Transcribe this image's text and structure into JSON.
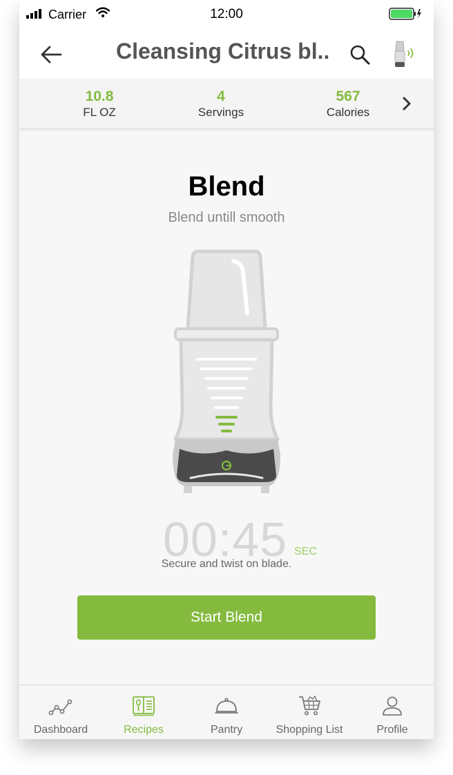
{
  "status_bar": {
    "carrier": "Carrier",
    "time": "12:00"
  },
  "nav": {
    "title": "Cleansing Citrus bl..",
    "back_icon": "arrow-left-icon",
    "search_icon": "search-icon",
    "device_icon": "blender-connected-icon"
  },
  "stats": [
    {
      "value": "10.8",
      "label": "FL OZ"
    },
    {
      "value": "4",
      "label": "Servings"
    },
    {
      "value": "567",
      "label": "Calories"
    }
  ],
  "step": {
    "title": "Blend",
    "description": "Blend untill smooth",
    "timer": "00:45",
    "timer_unit": "SEC",
    "note": "Secure and twist on blade.",
    "button_label": "Start Blend"
  },
  "tabs": [
    {
      "label": "Dashboard",
      "icon": "chart-line-icon",
      "active": false
    },
    {
      "label": "Recipes",
      "icon": "recipe-book-icon",
      "active": true
    },
    {
      "label": "Pantry",
      "icon": "cloche-icon",
      "active": false
    },
    {
      "label": "Shopping List",
      "icon": "shopping-cart-icon",
      "active": false
    },
    {
      "label": "Profile",
      "icon": "user-icon",
      "active": false
    }
  ],
  "colors": {
    "accent": "#84bb3f",
    "title_gray": "#555555",
    "timer_gray": "#d7d7d7"
  }
}
